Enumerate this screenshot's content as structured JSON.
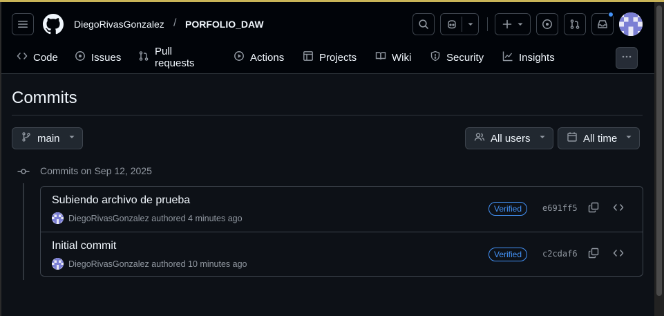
{
  "header": {
    "owner": "DiegoRivasGonzalez",
    "separator": "/",
    "repo": "PORFOLIO_DAW"
  },
  "nav": {
    "items": [
      {
        "label": "Code",
        "icon": "code-icon"
      },
      {
        "label": "Issues",
        "icon": "issue-opened-icon"
      },
      {
        "label": "Pull requests",
        "icon": "git-pull-request-icon"
      },
      {
        "label": "Actions",
        "icon": "play-icon"
      },
      {
        "label": "Projects",
        "icon": "table-icon"
      },
      {
        "label": "Wiki",
        "icon": "book-icon"
      },
      {
        "label": "Security",
        "icon": "shield-icon"
      },
      {
        "label": "Insights",
        "icon": "graph-icon"
      }
    ]
  },
  "main": {
    "title": "Commits",
    "branch": "main",
    "users_filter": "All users",
    "time_filter": "All time",
    "group_label": "Commits on Sep 12, 2025",
    "commits": [
      {
        "message": "Subiendo archivo de prueba",
        "author": "DiegoRivasGonzalez",
        "action": "authored 4 minutes ago",
        "badge": "Verified",
        "sha": "e691ff5"
      },
      {
        "message": "Initial commit",
        "author": "DiegoRivasGonzalez",
        "action": "authored 10 minutes ago",
        "badge": "Verified",
        "sha": "c2cdaf6"
      }
    ]
  },
  "colors": {
    "page_bg": "#0d1117",
    "header_bg": "#010409",
    "accent_blue": "#4493f8",
    "border": "#3d444d",
    "muted_text": "#9198a1"
  }
}
